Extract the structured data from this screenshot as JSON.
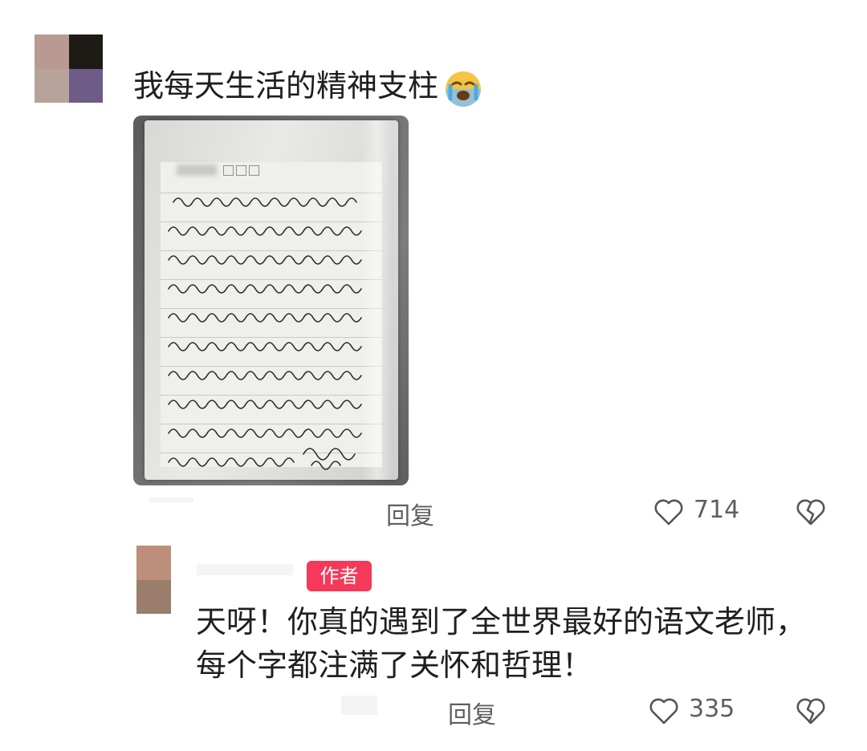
{
  "comment": {
    "text": "我每天生活的精神支柱",
    "emoji": "loudly-crying-face",
    "actions": {
      "reply_label": "回复",
      "like_count": "714"
    }
  },
  "reply": {
    "badge": "作者",
    "text": "天呀！你真的遇到了全世界最好的语文老师，每个字都注满了关怀和哲理！",
    "actions": {
      "reply_label": "回复",
      "like_count": "335"
    }
  },
  "colors": {
    "badge_bg": "#f4395a",
    "muted_text": "#5f5f5f",
    "icon_stroke": "#555555"
  }
}
